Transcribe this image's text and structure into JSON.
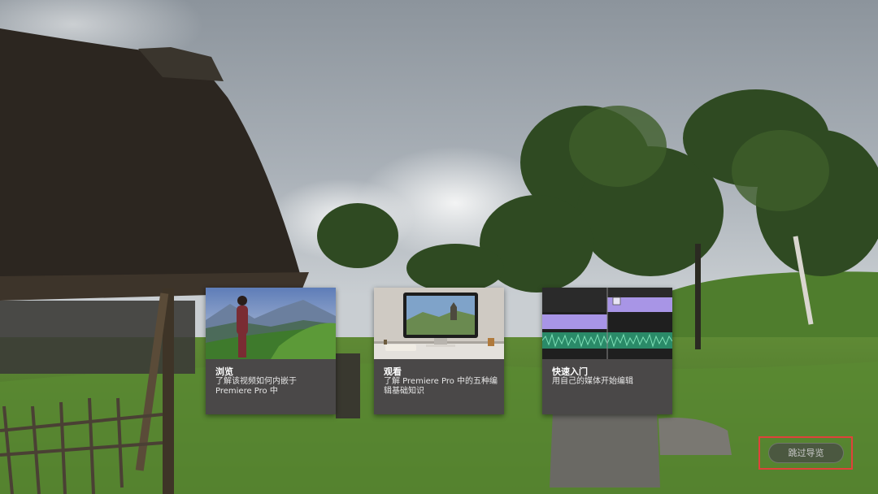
{
  "cards": [
    {
      "title": "浏览",
      "description": "了解该视频如何内嵌于 Premiere Pro 中"
    },
    {
      "title": "观看",
      "description": "了解 Premiere Pro 中的五种编辑基础知识"
    },
    {
      "title": "快速入门",
      "description": "用自己的媒体开始编辑"
    }
  ],
  "skip_button": {
    "label": "跳过导览"
  },
  "colors": {
    "card_bg": "#4a4848",
    "highlight_border": "#e0423a",
    "timeline_purple": "#a895e6",
    "timeline_green": "#3fb98f"
  }
}
